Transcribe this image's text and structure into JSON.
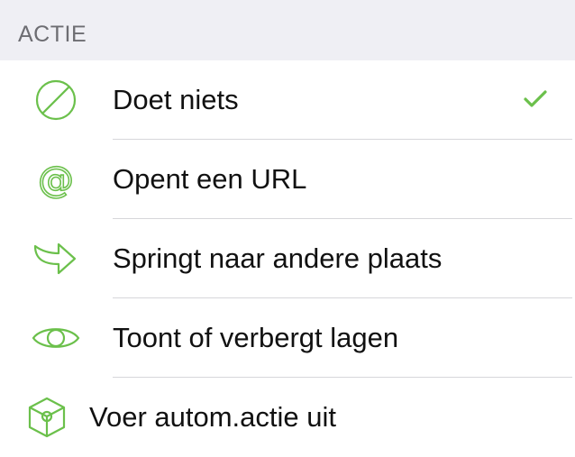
{
  "section": {
    "title": "ACTIE"
  },
  "accent_color": "#6bc04b",
  "options": [
    {
      "label": "Doet niets",
      "icon": "prohibited-icon",
      "selected": true
    },
    {
      "label": "Opent een URL",
      "icon": "at-sign-icon",
      "selected": false
    },
    {
      "label": "Springt naar andere plaats",
      "icon": "jump-arrow-icon",
      "selected": false
    },
    {
      "label": "Toont of verbergt lagen",
      "icon": "eye-icon",
      "selected": false
    },
    {
      "label": "Voer autom.actie uit",
      "icon": "automation-cube-icon",
      "selected": false
    }
  ]
}
